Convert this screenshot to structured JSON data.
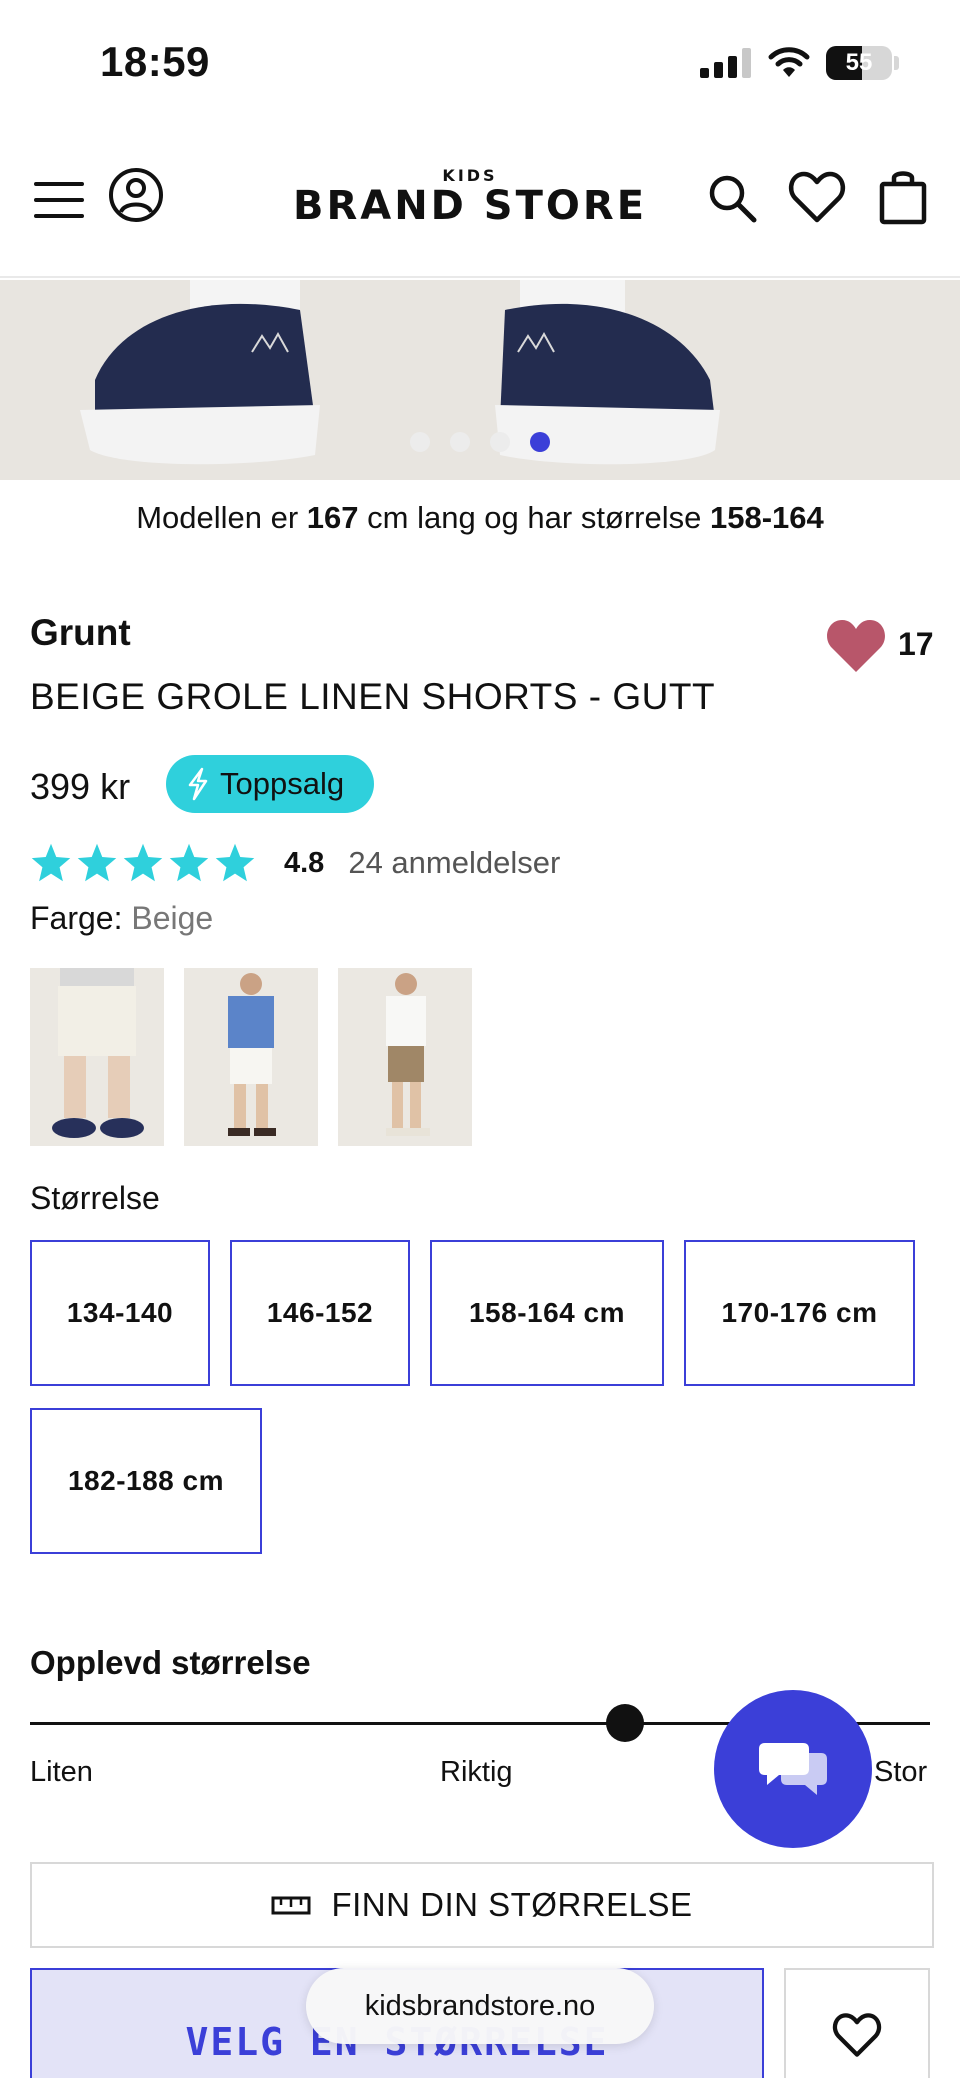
{
  "status_bar": {
    "time": "18:59",
    "battery": "55"
  },
  "header": {
    "logo_small": "KIDS",
    "logo_main": "BRAND STORE"
  },
  "carousel": {
    "slide_count": 4,
    "active_index": 3
  },
  "model_info": {
    "prefix": "Modellen er ",
    "height": "167",
    "middle": " cm lang og har størrelse ",
    "size": "158-164"
  },
  "product": {
    "brand": "Grunt",
    "title": "BEIGE GROLE LINEN SHORTS - GUTT",
    "favorites_count": "17",
    "price": "399 kr",
    "badge": "Toppsalg",
    "rating_value": "4.8",
    "rating_stars": 5,
    "review_count": "24 anmeldelser",
    "color_label": "Farge:",
    "color_value": "Beige"
  },
  "sizes": {
    "label": "Størrelse",
    "options": [
      "134-140",
      "146-152",
      "158-164 cm",
      "170-176 cm",
      "182-188 cm"
    ]
  },
  "fit": {
    "heading": "Opplevd størrelse",
    "left": "Liten",
    "middle": "Riktig",
    "right": "Stor"
  },
  "actions": {
    "find_size": "FINN DIN STØRRELSE",
    "choose_size": "VELG EN STØRRELSE"
  },
  "browser": {
    "url": "kidsbrandstore.no"
  },
  "colors": {
    "accent": "#3b3fd8",
    "badge": "#2fd0dc",
    "heart": "#b8566a",
    "star": "#2fd0dc"
  }
}
